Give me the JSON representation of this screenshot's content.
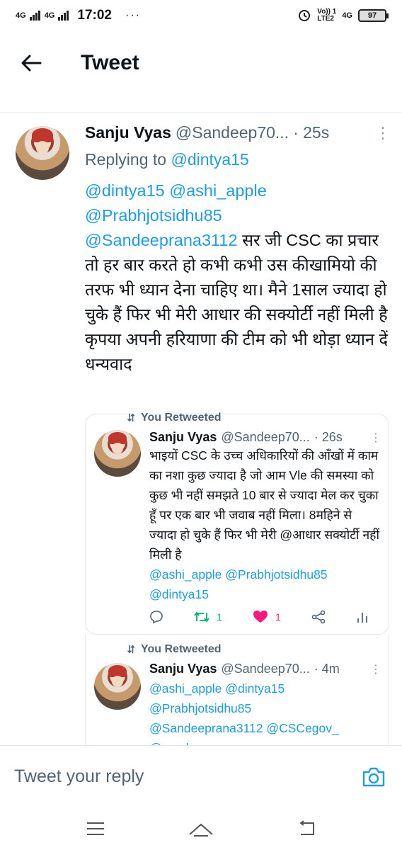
{
  "status_bar": {
    "net1": "4G",
    "net2": "4G",
    "time": "17:02",
    "dots": "···",
    "volte": "Vo)) 1",
    "lte": "LTE2",
    "net3": "4G",
    "battery": "97"
  },
  "header": {
    "title": "Tweet"
  },
  "main_tweet": {
    "name": "Sanju Vyas",
    "handle": "@Sandeep70...",
    "time": "· 25s",
    "replying_prefix": "Replying to ",
    "replying_handle": "@dintya15",
    "mentions_line1": "@dintya15 @ashi_apple",
    "mentions_line2": "@Prabhjotsidhu85",
    "mentions_line3": "@Sandeeprana3112",
    "text": "सर जी CSC का प्रचार तो हर बार करते हो कभी कभी उस कीखामियो की तरफ भी ध्यान देना चाहिए था। मैने 1साल ज्यादा हो चुके हैं फिर भी मेरी आधार की सक्योर्टी नहीं मिली है कृपया अपनी हरियाणा की टीम को भी थोड़ा ध्यान दें धन्यवाद"
  },
  "thread": [
    {
      "retweet_label": "You Retweeted",
      "name": "Sanju Vyas",
      "handle": "@Sandeep70...",
      "time": "· 26s",
      "text": "भाइयों CSC के उच्च अधिकारियों की आँखों में काम का नशा कुछ ज्यादा है जो आम Vle की समस्या को कुछ भी नहीं समझते 10 बार से ज्यादा मेल कर चुका हूँ पर एक बार भी जवाब नहीं मिला। 8महिने से ज्यादा हो चुके हैं फिर भी मेरी @आधार सक्योर्टी नहीं  मिली है",
      "mentions_line1": "@ashi_apple @Prabhjotsidhu85",
      "mentions_line2": "@dintya15",
      "retweets": "1",
      "likes": "1"
    },
    {
      "retweet_label": "You Retweeted",
      "name": "Sanju Vyas",
      "handle": "@Sandeep70...",
      "time": "· 4m",
      "mentions_line1": "@ashi_apple @dintya15",
      "mentions_line2": "@Prabhjotsidhu85",
      "mentions_line3": "@Sandeeprana3112 @CSCegov_",
      "mentions_line4": "@amahry"
    }
  ],
  "reply": {
    "placeholder": "Tweet your reply"
  },
  "colors": {
    "link": "#1d9bf0",
    "secondary_text": "#536471",
    "retweet_active": "#00ba7c",
    "like_active": "#f91880"
  },
  "icons": [
    "back-arrow-icon",
    "more-icon",
    "retweet-icon",
    "reply-icon",
    "heart-icon",
    "share-icon",
    "analytics-icon",
    "camera-icon",
    "menu-icon",
    "home-icon",
    "back-nav-icon"
  ]
}
